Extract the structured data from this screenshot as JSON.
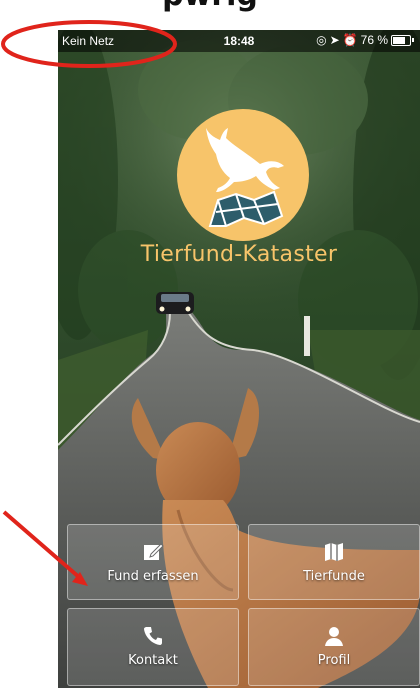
{
  "header_caption": "pwrig",
  "status_bar": {
    "carrier": "Kein Netz",
    "time": "18:48",
    "battery_percent": "76 %",
    "battery_level": 0.76,
    "icons": [
      "orientation-lock-icon",
      "location-arrow-icon",
      "alarm-icon",
      "battery-icon"
    ]
  },
  "app": {
    "title": "Tierfund-Kataster",
    "logo": "deer-over-map-logo",
    "accent_color": "#f7c46a"
  },
  "menu": [
    {
      "label": "Fund erfassen",
      "icon": "edit-icon"
    },
    {
      "label": "Tierfunde",
      "icon": "map-icon"
    },
    {
      "label": "Kontakt",
      "icon": "phone-icon"
    },
    {
      "label": "Profil",
      "icon": "user-icon"
    }
  ],
  "annotation_color": "#e0241b"
}
